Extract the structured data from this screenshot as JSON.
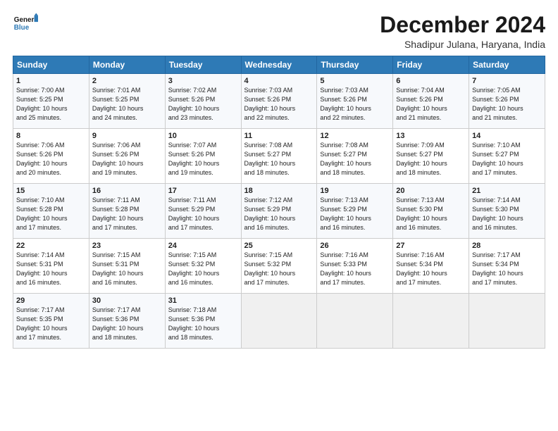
{
  "logo": {
    "line1": "General",
    "line2": "Blue"
  },
  "title": "December 2024",
  "subtitle": "Shadipur Julana, Haryana, India",
  "days_of_week": [
    "Sunday",
    "Monday",
    "Tuesday",
    "Wednesday",
    "Thursday",
    "Friday",
    "Saturday"
  ],
  "weeks": [
    [
      {
        "day": "1",
        "info": "Sunrise: 7:00 AM\nSunset: 5:25 PM\nDaylight: 10 hours\nand 25 minutes."
      },
      {
        "day": "2",
        "info": "Sunrise: 7:01 AM\nSunset: 5:25 PM\nDaylight: 10 hours\nand 24 minutes."
      },
      {
        "day": "3",
        "info": "Sunrise: 7:02 AM\nSunset: 5:26 PM\nDaylight: 10 hours\nand 23 minutes."
      },
      {
        "day": "4",
        "info": "Sunrise: 7:03 AM\nSunset: 5:26 PM\nDaylight: 10 hours\nand 22 minutes."
      },
      {
        "day": "5",
        "info": "Sunrise: 7:03 AM\nSunset: 5:26 PM\nDaylight: 10 hours\nand 22 minutes."
      },
      {
        "day": "6",
        "info": "Sunrise: 7:04 AM\nSunset: 5:26 PM\nDaylight: 10 hours\nand 21 minutes."
      },
      {
        "day": "7",
        "info": "Sunrise: 7:05 AM\nSunset: 5:26 PM\nDaylight: 10 hours\nand 21 minutes."
      }
    ],
    [
      {
        "day": "8",
        "info": "Sunrise: 7:06 AM\nSunset: 5:26 PM\nDaylight: 10 hours\nand 20 minutes."
      },
      {
        "day": "9",
        "info": "Sunrise: 7:06 AM\nSunset: 5:26 PM\nDaylight: 10 hours\nand 19 minutes."
      },
      {
        "day": "10",
        "info": "Sunrise: 7:07 AM\nSunset: 5:26 PM\nDaylight: 10 hours\nand 19 minutes."
      },
      {
        "day": "11",
        "info": "Sunrise: 7:08 AM\nSunset: 5:27 PM\nDaylight: 10 hours\nand 18 minutes."
      },
      {
        "day": "12",
        "info": "Sunrise: 7:08 AM\nSunset: 5:27 PM\nDaylight: 10 hours\nand 18 minutes."
      },
      {
        "day": "13",
        "info": "Sunrise: 7:09 AM\nSunset: 5:27 PM\nDaylight: 10 hours\nand 18 minutes."
      },
      {
        "day": "14",
        "info": "Sunrise: 7:10 AM\nSunset: 5:27 PM\nDaylight: 10 hours\nand 17 minutes."
      }
    ],
    [
      {
        "day": "15",
        "info": "Sunrise: 7:10 AM\nSunset: 5:28 PM\nDaylight: 10 hours\nand 17 minutes."
      },
      {
        "day": "16",
        "info": "Sunrise: 7:11 AM\nSunset: 5:28 PM\nDaylight: 10 hours\nand 17 minutes."
      },
      {
        "day": "17",
        "info": "Sunrise: 7:11 AM\nSunset: 5:29 PM\nDaylight: 10 hours\nand 17 minutes."
      },
      {
        "day": "18",
        "info": "Sunrise: 7:12 AM\nSunset: 5:29 PM\nDaylight: 10 hours\nand 16 minutes."
      },
      {
        "day": "19",
        "info": "Sunrise: 7:13 AM\nSunset: 5:29 PM\nDaylight: 10 hours\nand 16 minutes."
      },
      {
        "day": "20",
        "info": "Sunrise: 7:13 AM\nSunset: 5:30 PM\nDaylight: 10 hours\nand 16 minutes."
      },
      {
        "day": "21",
        "info": "Sunrise: 7:14 AM\nSunset: 5:30 PM\nDaylight: 10 hours\nand 16 minutes."
      }
    ],
    [
      {
        "day": "22",
        "info": "Sunrise: 7:14 AM\nSunset: 5:31 PM\nDaylight: 10 hours\nand 16 minutes."
      },
      {
        "day": "23",
        "info": "Sunrise: 7:15 AM\nSunset: 5:31 PM\nDaylight: 10 hours\nand 16 minutes."
      },
      {
        "day": "24",
        "info": "Sunrise: 7:15 AM\nSunset: 5:32 PM\nDaylight: 10 hours\nand 16 minutes."
      },
      {
        "day": "25",
        "info": "Sunrise: 7:15 AM\nSunset: 5:32 PM\nDaylight: 10 hours\nand 17 minutes."
      },
      {
        "day": "26",
        "info": "Sunrise: 7:16 AM\nSunset: 5:33 PM\nDaylight: 10 hours\nand 17 minutes."
      },
      {
        "day": "27",
        "info": "Sunrise: 7:16 AM\nSunset: 5:34 PM\nDaylight: 10 hours\nand 17 minutes."
      },
      {
        "day": "28",
        "info": "Sunrise: 7:17 AM\nSunset: 5:34 PM\nDaylight: 10 hours\nand 17 minutes."
      }
    ],
    [
      {
        "day": "29",
        "info": "Sunrise: 7:17 AM\nSunset: 5:35 PM\nDaylight: 10 hours\nand 17 minutes."
      },
      {
        "day": "30",
        "info": "Sunrise: 7:17 AM\nSunset: 5:36 PM\nDaylight: 10 hours\nand 18 minutes."
      },
      {
        "day": "31",
        "info": "Sunrise: 7:18 AM\nSunset: 5:36 PM\nDaylight: 10 hours\nand 18 minutes."
      },
      {
        "day": "",
        "info": ""
      },
      {
        "day": "",
        "info": ""
      },
      {
        "day": "",
        "info": ""
      },
      {
        "day": "",
        "info": ""
      }
    ]
  ]
}
